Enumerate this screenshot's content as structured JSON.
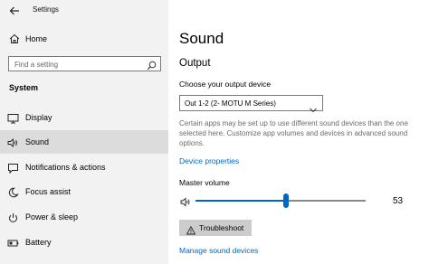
{
  "window": {
    "title": "Settings"
  },
  "sidebar": {
    "home_label": "Home",
    "search_placeholder": "Find a setting",
    "section_label": "System",
    "items": [
      {
        "label": "Display",
        "icon": "display-icon",
        "active": false
      },
      {
        "label": "Sound",
        "icon": "speaker-icon",
        "active": true
      },
      {
        "label": "Notifications & actions",
        "icon": "notification-icon",
        "active": false
      },
      {
        "label": "Focus assist",
        "icon": "moon-icon",
        "active": false
      },
      {
        "label": "Power & sleep",
        "icon": "power-icon",
        "active": false
      },
      {
        "label": "Battery",
        "icon": "battery-icon",
        "active": false
      }
    ]
  },
  "main": {
    "title": "Sound",
    "output_heading": "Output",
    "choose_device_label": "Choose your output device",
    "selected_device": "Out 1-2 (2- MOTU M Series)",
    "description": "Certain apps may be set up to use different sound devices than the one selected here. Customize app volumes and devices in advanced sound options.",
    "device_properties_link": "Device properties",
    "master_volume_label": "Master volume",
    "volume": 53,
    "troubleshoot_label": "Troubleshoot",
    "manage_devices_link": "Manage sound devices"
  },
  "colors": {
    "accent": "#0067c0",
    "sidebar_bg": "#f2f2f2",
    "active_item_bg": "#dcdcdc",
    "button_bg": "#cccccc"
  }
}
